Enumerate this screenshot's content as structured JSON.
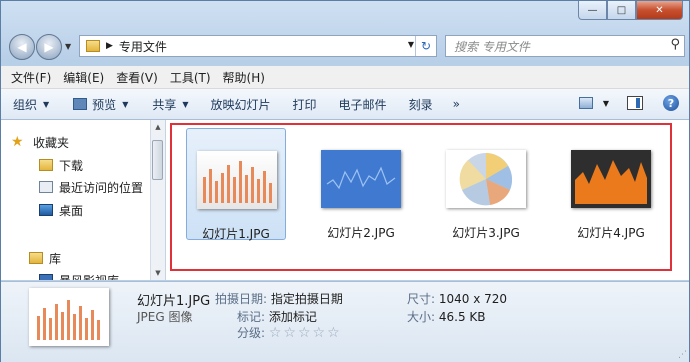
{
  "window": {
    "caption": {
      "minimize": "—",
      "maximize": "□",
      "close": "✕"
    }
  },
  "nav": {
    "back_glyph": "◀",
    "forward_glyph": "▶",
    "dropdown_glyph": "▼",
    "address_sep": "▶",
    "address_path": "专用文件",
    "refresh_glyph": "↻",
    "search_placeholder": "搜索 专用文件",
    "search_glyph": "⚲"
  },
  "menubar": [
    "文件(F)",
    "编辑(E)",
    "查看(V)",
    "工具(T)",
    "帮助(H)"
  ],
  "toolbar": {
    "organize": "组织",
    "preview": "预览",
    "share": "共享",
    "slideshow": "放映幻灯片",
    "print": "打印",
    "email": "电子邮件",
    "burn": "刻录",
    "more": "»",
    "dropdown_glyph": "▼",
    "help": "?"
  },
  "sidebar": {
    "items": [
      {
        "label": "收藏夹",
        "icon": "star-icon"
      },
      {
        "label": "下载",
        "icon": "download-folder-icon"
      },
      {
        "label": "最近访问的位置",
        "icon": "recent-places-icon"
      },
      {
        "label": "桌面",
        "icon": "desktop-icon"
      },
      {
        "label": "库",
        "icon": "library-icon"
      },
      {
        "label": "暴风影视库",
        "icon": "video-library-icon"
      }
    ],
    "expand_glyph": "▲",
    "star_glyph": "★"
  },
  "files": [
    {
      "name": "幻灯片1.JPG",
      "selected": true,
      "kind": "bar-chart-thumbnail"
    },
    {
      "name": "幻灯片2.JPG",
      "selected": false,
      "kind": "line-chart-thumbnail"
    },
    {
      "name": "幻灯片3.JPG",
      "selected": false,
      "kind": "pie-chart-thumbnail"
    },
    {
      "name": "幻灯片4.JPG",
      "selected": false,
      "kind": "area-chart-thumbnail"
    }
  ],
  "details": {
    "name": "幻灯片1.JPG",
    "type": "JPEG 图像",
    "date_label": "拍摄日期:",
    "date_value": "指定拍摄日期",
    "tag_label": "标记:",
    "tag_value": "添加标记",
    "rating_label": "分级:",
    "rating_stars": "☆☆☆☆☆",
    "dims_label": "尺寸:",
    "dims_value": "1040 x 720",
    "size_label": "大小:",
    "size_value": "46.5 KB"
  },
  "colors": {
    "highlight_border": "#e0303a",
    "bar_orange": "#e8895a",
    "line_bg": "#3f7ad0",
    "area_orange": "#ea7a1c"
  }
}
